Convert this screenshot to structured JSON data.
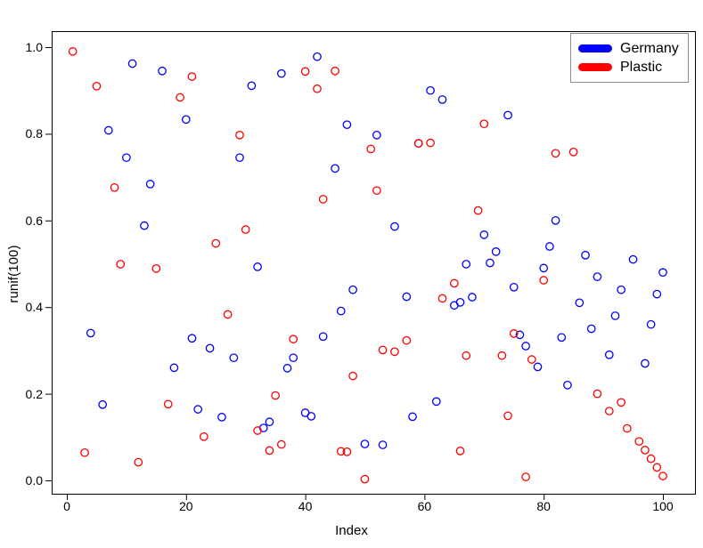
{
  "chart_data": {
    "type": "scatter",
    "title": "",
    "xlabel": "Index",
    "ylabel": "runif(100)",
    "xlim": [
      0,
      101
    ],
    "ylim": [
      0.0,
      1.0
    ],
    "grid": false,
    "xticks": [
      "0",
      "20",
      "40",
      "60",
      "80",
      "100"
    ],
    "xtick_values": [
      0,
      20,
      40,
      60,
      80,
      100
    ],
    "yticks": [
      "0.0",
      "0.2",
      "0.4",
      "0.6",
      "0.8",
      "1.0"
    ],
    "ytick_values": [
      0.0,
      0.2,
      0.4,
      0.6,
      0.8,
      1.0
    ],
    "legend": {
      "position": "top-right",
      "entries": [
        {
          "name": "Germany",
          "color": "#0000ff"
        },
        {
          "name": "Plastic",
          "color": "#ff0000"
        }
      ]
    },
    "marker": {
      "shape": "open-circle",
      "radius": 4.2,
      "stroke_width": 1.3
    },
    "series": [
      {
        "name": "Germany",
        "color": "#0000ff",
        "x": [
          4,
          6,
          7,
          10,
          11,
          13,
          14,
          16,
          18,
          20,
          21,
          22,
          24,
          26,
          28,
          29,
          31,
          32,
          33,
          34,
          36,
          37,
          38,
          40,
          41,
          42,
          43,
          45,
          46,
          47,
          48,
          50,
          52,
          53,
          55,
          57,
          58,
          59,
          61,
          62,
          63,
          65,
          66,
          67,
          68,
          70,
          71,
          72,
          74,
          75,
          76,
          77,
          79,
          80,
          81,
          82,
          83,
          84,
          86,
          87,
          88,
          89,
          91,
          92,
          93,
          95,
          97,
          98,
          99,
          100
        ],
        "y": [
          0.34,
          0.175,
          0.808,
          0.745,
          0.962,
          0.588,
          0.684,
          0.945,
          0.26,
          0.833,
          0.328,
          0.164,
          0.305,
          0.146,
          0.283,
          0.745,
          0.911,
          0.493,
          0.121,
          0.135,
          0.939,
          0.259,
          0.283,
          0.156,
          0.148,
          0.978,
          0.332,
          0.72,
          0.391,
          0.821,
          0.44,
          0.084,
          0.797,
          0.082,
          0.586,
          0.424,
          0.147,
          0.778,
          0.9,
          0.182,
          0.879,
          0.404,
          0.411,
          0.499,
          0.423,
          0.567,
          0.502,
          0.528,
          0.843,
          0.446,
          0.336,
          0.31,
          0.262,
          0.49,
          0.54,
          0.6,
          0.33,
          0.22,
          0.41,
          0.52,
          0.35,
          0.47,
          0.29,
          0.38,
          0.44,
          0.51,
          0.27,
          0.36,
          0.43,
          0.48
        ]
      },
      {
        "name": "Plastic",
        "color": "#ff0000",
        "x": [
          1,
          3,
          5,
          8,
          9,
          12,
          15,
          17,
          19,
          21,
          23,
          25,
          27,
          29,
          30,
          32,
          34,
          35,
          36,
          38,
          40,
          42,
          43,
          45,
          46,
          47,
          48,
          50,
          51,
          52,
          53,
          55,
          57,
          59,
          61,
          63,
          65,
          66,
          67,
          69,
          70,
          73,
          74,
          75,
          77,
          78,
          80,
          82,
          85,
          89,
          91,
          93,
          94,
          96,
          97,
          98,
          99,
          100
        ],
        "y": [
          0.99,
          0.064,
          0.91,
          0.676,
          0.499,
          0.042,
          0.489,
          0.176,
          0.884,
          0.932,
          0.101,
          0.547,
          0.383,
          0.797,
          0.579,
          0.115,
          0.069,
          0.196,
          0.083,
          0.326,
          0.944,
          0.904,
          0.649,
          0.945,
          0.067,
          0.066,
          0.241,
          0.003,
          0.765,
          0.669,
          0.301,
          0.297,
          0.323,
          0.778,
          0.779,
          0.42,
          0.455,
          0.068,
          0.288,
          0.623,
          0.823,
          0.288,
          0.149,
          0.339,
          0.008,
          0.279,
          0.462,
          0.755,
          0.758,
          0.2,
          0.16,
          0.18,
          0.12,
          0.09,
          0.07,
          0.05,
          0.03,
          0.01
        ]
      }
    ]
  },
  "axes": {
    "ylabel": "runif(100)",
    "xlabel": "Index"
  },
  "legend": {
    "entries": [
      {
        "label": "Germany"
      },
      {
        "label": "Plastic"
      }
    ]
  }
}
